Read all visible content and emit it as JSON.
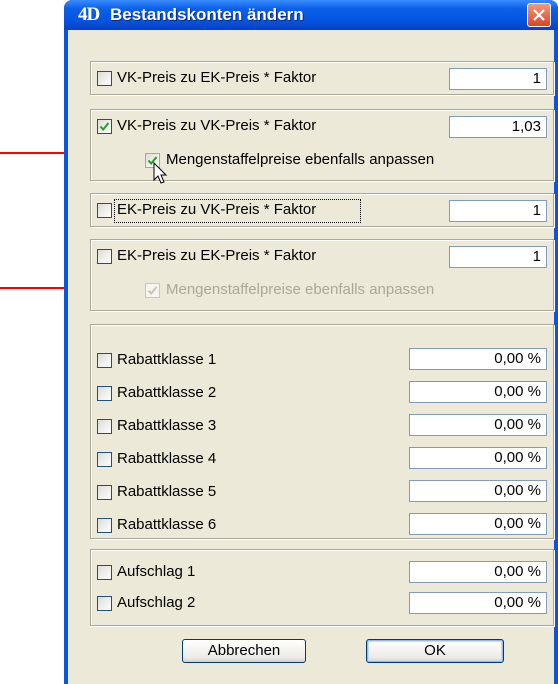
{
  "window": {
    "logo": "4D",
    "title": "Bestandskonten ändern"
  },
  "price_options": [
    {
      "label": "VK-Preis zu EK-Preis * Faktor",
      "checked": false,
      "value": "1"
    },
    {
      "label": "VK-Preis zu VK-Preis * Faktor",
      "checked": true,
      "value": "1,03",
      "sub": {
        "label": "Mengenstaffelpreise ebenfalls anpassen",
        "checked": true,
        "enabled": true
      }
    },
    {
      "label": "EK-Preis zu VK-Preis * Faktor",
      "checked": false,
      "value": "1"
    },
    {
      "label": "EK-Preis zu EK-Preis * Faktor",
      "checked": false,
      "value": "1",
      "sub": {
        "label": "Mengenstaffelpreise ebenfalls anpassen",
        "checked": true,
        "enabled": false
      }
    }
  ],
  "rabatt": [
    {
      "label": "Rabattklasse 1",
      "value": "0,00 %"
    },
    {
      "label": "Rabattklasse 2",
      "value": "0,00 %"
    },
    {
      "label": "Rabattklasse 3",
      "value": "0,00 %"
    },
    {
      "label": "Rabattklasse 4",
      "value": "0,00 %"
    },
    {
      "label": "Rabattklasse 5",
      "value": "0,00 %"
    },
    {
      "label": "Rabattklasse 6",
      "value": "0,00 %"
    }
  ],
  "aufschlag": [
    {
      "label": "Aufschlag 1",
      "value": "0,00 %"
    },
    {
      "label": "Aufschlag 2",
      "value": "0,00 %"
    }
  ],
  "buttons": {
    "cancel": "Abbrechen",
    "ok": "OK"
  },
  "colors": {
    "title_bar": "#0454e0",
    "dialog_bg": "#ece9d8",
    "annotation_arrow": "#ff0000",
    "check": "#21a121"
  }
}
